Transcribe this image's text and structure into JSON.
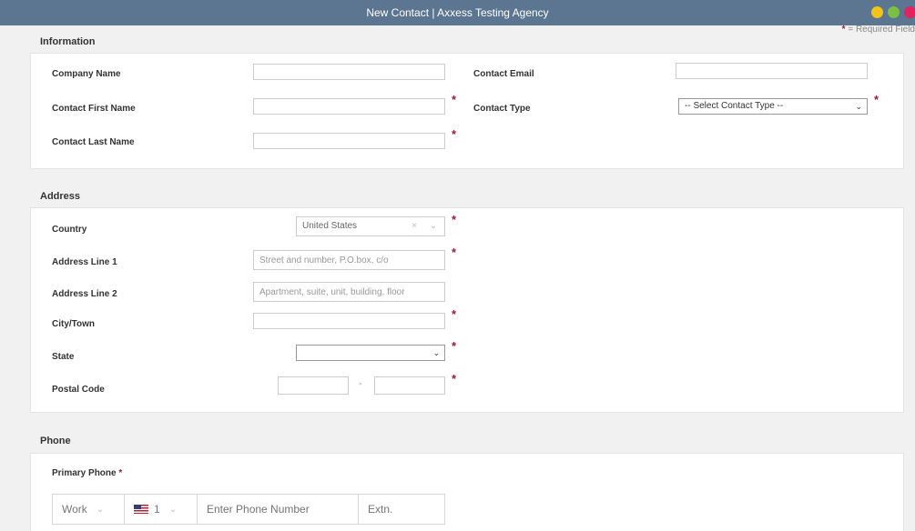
{
  "window": {
    "title": "New Contact | Axxess Testing Agency"
  },
  "required_note": {
    "star": "*",
    "text": " = Required Field"
  },
  "information": {
    "heading": "Information",
    "company_name_label": "Company Name",
    "first_name_label": "Contact First Name",
    "last_name_label": "Contact Last Name",
    "email_label": "Contact Email",
    "type_label": "Contact Type",
    "type_value": "-- Select Contact Type --"
  },
  "address": {
    "heading": "Address",
    "country_label": "Country",
    "country_value": "United States",
    "line1_label": "Address Line 1",
    "line1_placeholder": "Street and number, P.O.box, c/o",
    "line2_label": "Address Line 2",
    "line2_placeholder": "Apartment, suite, unit, building, floor",
    "city_label": "City/Town",
    "state_label": "State",
    "postal_label": "Postal Code",
    "postal_sep": "-"
  },
  "phone": {
    "heading": "Phone",
    "primary_label": "Primary Phone",
    "type_value": "Work",
    "country_code": "1",
    "number_placeholder": "Enter Phone Number",
    "ext_placeholder": "Extn."
  },
  "required_star": "*",
  "colors": {
    "titlebar": "#5c7590",
    "required": "#9b1c31"
  }
}
